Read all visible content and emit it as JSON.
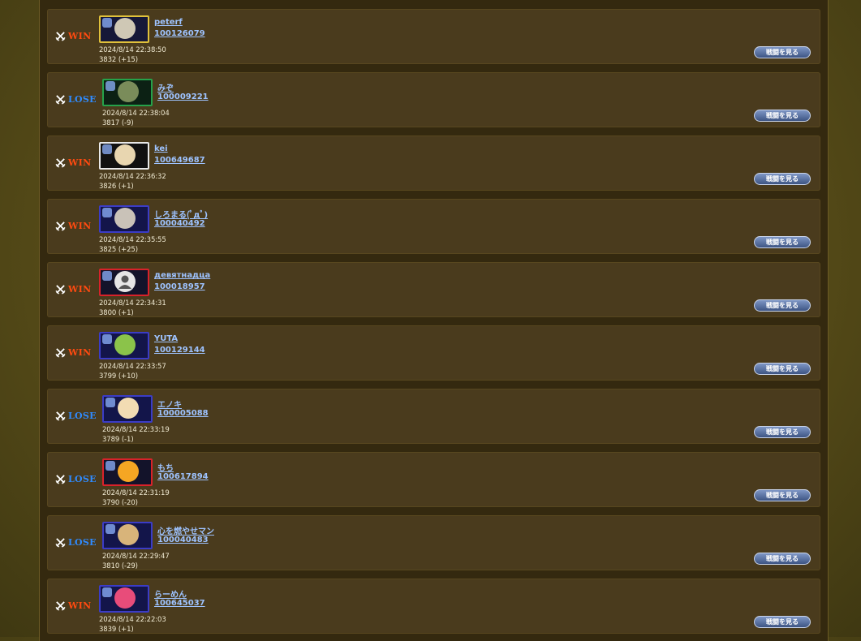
{
  "labels": {
    "win": "WIN",
    "lose": "LOSE",
    "view_button": "戦闘を見る"
  },
  "colors": {
    "win": "#ff4a10",
    "lose": "#2f8bff",
    "link": "#9ec3ff",
    "row_bg": "#4a3b1d"
  },
  "icons": {
    "result": "crossed-swords-icon",
    "default_avatar": "person-icon"
  },
  "battles": [
    {
      "result": "WIN",
      "name": "peterf",
      "id": "100126079",
      "datetime": "2024/8/14 22:38:50",
      "rating": "3832 (+15)",
      "frame": "gold"
    },
    {
      "result": "LOSE",
      "name": "みぞ",
      "id": "100009221",
      "datetime": "2024/8/14 22:38:04",
      "rating": "3817 (-9)",
      "frame": "green"
    },
    {
      "result": "WIN",
      "name": "kei",
      "id": "100649687",
      "datetime": "2024/8/14 22:36:32",
      "rating": "3826 (+1)",
      "frame": "white"
    },
    {
      "result": "WIN",
      "name": "しろまる(ﾟдﾟ)",
      "id": "100040492",
      "datetime": "2024/8/14 22:35:55",
      "rating": "3825 (+25)",
      "frame": "navy"
    },
    {
      "result": "WIN",
      "name": "девятнадцa",
      "id": "100018957",
      "datetime": "2024/8/14 22:34:31",
      "rating": "3800 (+1)",
      "frame": "red"
    },
    {
      "result": "WIN",
      "name": "YUTA",
      "id": "100129144",
      "datetime": "2024/8/14 22:33:57",
      "rating": "3799 (+10)",
      "frame": "navy"
    },
    {
      "result": "LOSE",
      "name": "エノキ",
      "id": "100005088",
      "datetime": "2024/8/14 22:33:19",
      "rating": "3789 (-1)",
      "frame": "navy"
    },
    {
      "result": "LOSE",
      "name": "もち",
      "id": "100617894",
      "datetime": "2024/8/14 22:31:19",
      "rating": "3790 (-20)",
      "frame": "red"
    },
    {
      "result": "LOSE",
      "name": "心を燃やせマン",
      "id": "100040483",
      "datetime": "2024/8/14 22:29:47",
      "rating": "3810 (-29)",
      "frame": "navy"
    },
    {
      "result": "WIN",
      "name": "らーめん",
      "id": "100645037",
      "datetime": "2024/8/14 22:22:03",
      "rating": "3839 (+1)",
      "frame": "navy"
    }
  ]
}
